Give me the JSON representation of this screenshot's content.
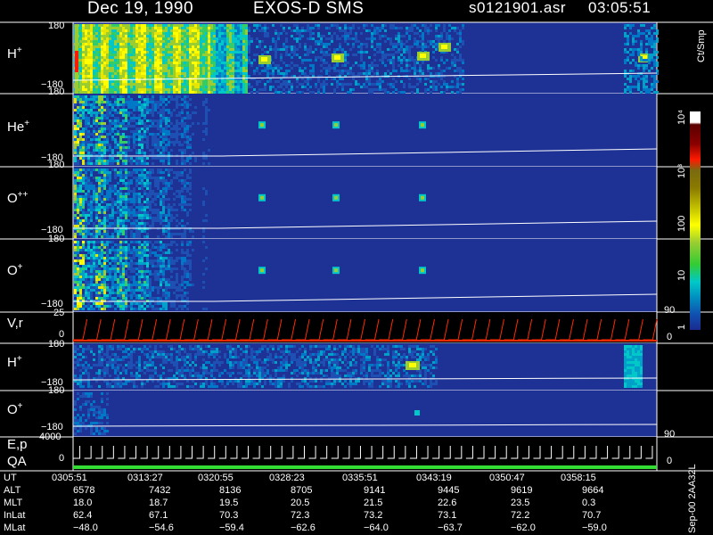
{
  "header": {
    "date": "Dec 19, 1990",
    "instrument": "EXOS-D SMS",
    "file": "s0121901.asr",
    "time": "03:05:51"
  },
  "footer_id": "Sep-00 2AA32L",
  "colorbar": {
    "label": "Ct/Smp",
    "ticks": [
      "10⁴",
      "10³",
      "100",
      "10",
      "1"
    ],
    "colors": [
      "#ffffff",
      "#c80000",
      "#ff1a00",
      "#8a6e00",
      "#c8c800",
      "#ffff00",
      "#9acd32",
      "#33cc33",
      "#00b0b0",
      "#0090c0",
      "#1050b0",
      "#1a2a90"
    ]
  },
  "panels": [
    {
      "label": "H",
      "charge": "+",
      "ytop": "180",
      "ybot": "−180"
    },
    {
      "label": "He",
      "charge": "+",
      "ytop": "180",
      "ybot": "−180"
    },
    {
      "label": "O",
      "charge": "++",
      "ytop": "180",
      "ybot": "−180"
    },
    {
      "label": "O",
      "charge": "+",
      "ytop": "180",
      "ybot": "−180"
    },
    {
      "label": "V,r",
      "charge": "",
      "ytop": "25",
      "ybot": "0",
      "right": [
        "90",
        "0"
      ]
    },
    {
      "label": "H",
      "charge": "+",
      "ytop": "180",
      "ybot": "−180"
    },
    {
      "label": "O",
      "charge": "+",
      "ytop": "180",
      "ybot": "−180"
    },
    {
      "label": "E,p",
      "label2": "QA",
      "ytop": "4000",
      "ybot": "0",
      "right": [
        "90",
        "0"
      ]
    }
  ],
  "table": {
    "rows": [
      {
        "name": "UT",
        "values": [
          "0305:51",
          "0313:27",
          "0320:55",
          "0328:23",
          "0335:51",
          "0343:19",
          "0350:47",
          "0358:15"
        ]
      },
      {
        "name": "ALT",
        "values": [
          "6578",
          "7432",
          "8136",
          "8705",
          "9141",
          "9445",
          "9619",
          "9664"
        ]
      },
      {
        "name": "MLT",
        "values": [
          "18.0",
          "18.7",
          "19.5",
          "20.5",
          "21.5",
          "22.6",
          "23.5",
          "0.3"
        ]
      },
      {
        "name": "InLat",
        "values": [
          "62.4",
          "67.1",
          "70.3",
          "72.3",
          "73.2",
          "73.1",
          "72.2",
          "70.7"
        ]
      },
      {
        "name": "MLat",
        "values": [
          "−48.0",
          "−54.6",
          "−59.4",
          "−62.6",
          "−64.0",
          "−63.7",
          "−62.0",
          "−59.0"
        ]
      }
    ]
  },
  "chart_data": {
    "type": "heatmap",
    "title": "Dec 19, 1990 EXOS-D SMS",
    "colorbar_label": "Ct/Smp",
    "colorbar_scale": "log",
    "colorbar_range": [
      1,
      10000
    ],
    "panels": [
      "H+",
      "He+",
      "O++",
      "O+",
      "V,r",
      "H+",
      "O+",
      "E,p QA"
    ],
    "ion_panel_ylim": [
      -180,
      180
    ],
    "x": [
      "0305:51",
      "0313:27",
      "0320:55",
      "0328:23",
      "0335:51",
      "0343:19",
      "0350:47",
      "0358:15"
    ]
  }
}
